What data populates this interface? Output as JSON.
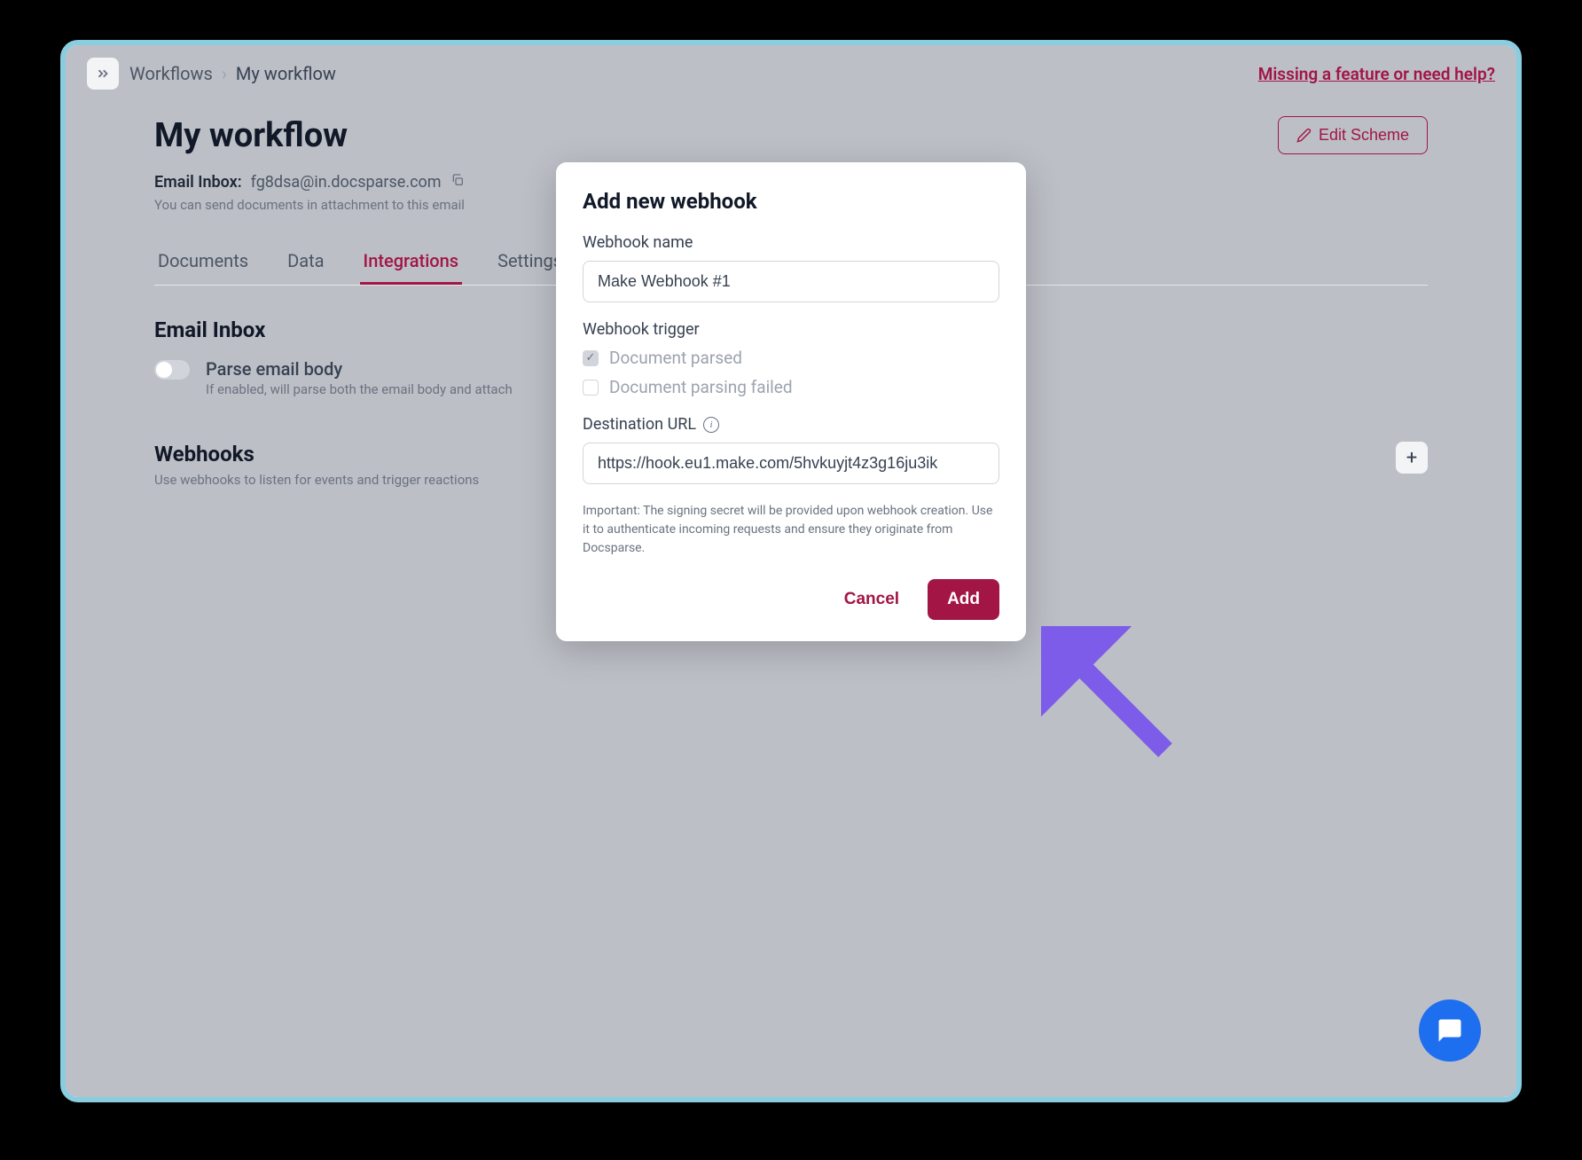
{
  "breadcrumb": {
    "root": "Workflows",
    "current": "My workflow"
  },
  "help_link": "Missing a feature or need help?",
  "page": {
    "title": "My workflow",
    "inbox_label": "Email Inbox:",
    "inbox_email": "fg8dsa@in.docsparse.com",
    "inbox_help": "You can send documents in attachment to this email",
    "edit_scheme": "Edit Scheme"
  },
  "tabs": {
    "documents": "Documents",
    "data": "Data",
    "integrations": "Integrations",
    "settings": "Settings"
  },
  "email_inbox_section": {
    "title": "Email Inbox",
    "toggle_title": "Parse email body",
    "toggle_desc": "If enabled, will parse both the email body and attach"
  },
  "webhooks_section": {
    "title": "Webhooks",
    "desc": "Use webhooks to listen for events and trigger reactions"
  },
  "modal": {
    "title": "Add new webhook",
    "name_label": "Webhook name",
    "name_value": "Make Webhook #1",
    "trigger_label": "Webhook trigger",
    "trigger_parsed": "Document parsed",
    "trigger_failed": "Document parsing failed",
    "dest_label": "Destination URL",
    "dest_value": "https://hook.eu1.make.com/5hvkuyjt4z3g16ju3ik",
    "hint": "Important: The signing secret will be provided upon webhook creation. Use it to authenticate incoming requests and ensure they originate from Docsparse.",
    "cancel": "Cancel",
    "add": "Add"
  }
}
